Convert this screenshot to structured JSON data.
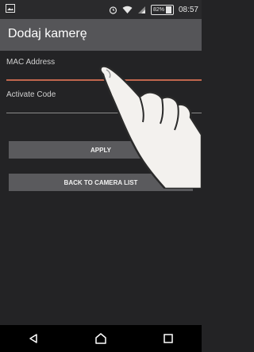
{
  "status_bar": {
    "battery": "82%",
    "time": "08:57",
    "icons": [
      "image-notification-icon",
      "alarm-icon",
      "wifi-icon",
      "signal-icon",
      "battery-icon"
    ]
  },
  "app_bar": {
    "title": "Dodaj kamerę"
  },
  "form": {
    "mac_label": "MAC Address",
    "mac_value": "",
    "code_label": "Activate Code",
    "code_value": ""
  },
  "buttons": {
    "apply": "APPLY",
    "back": "BACK TO CAMERA LIST"
  },
  "nav": {
    "icons": [
      "back-icon",
      "home-icon",
      "recents-icon"
    ]
  },
  "colors": {
    "background": "#232325",
    "app_bar": "#555558",
    "focused_underline": "#c0664e",
    "button": "#5a5a5d"
  }
}
